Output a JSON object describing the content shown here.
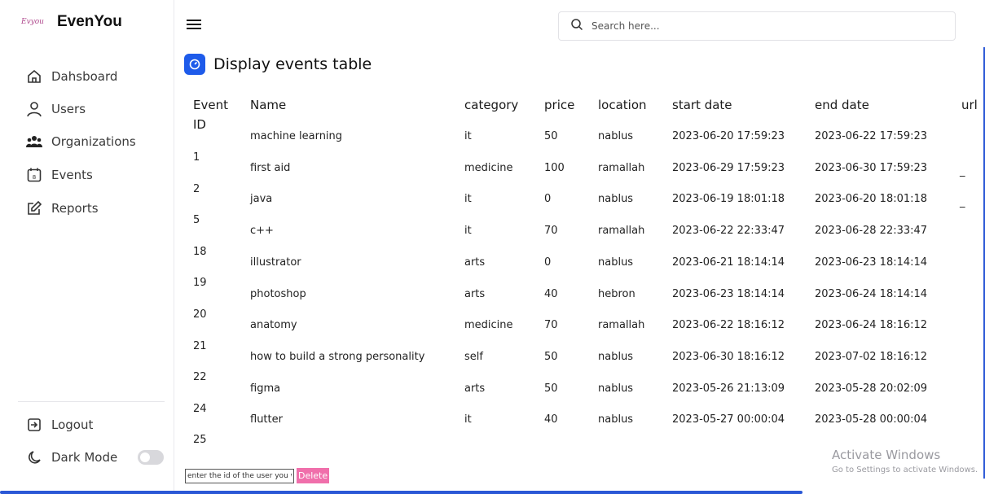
{
  "brand": {
    "logo_text": "Evyou",
    "name": "EvenYou"
  },
  "sidebar": {
    "items": [
      {
        "label": "Dahsboard",
        "icon": "home-icon"
      },
      {
        "label": "Users",
        "icon": "user-icon"
      },
      {
        "label": "Organizations",
        "icon": "users-group-icon"
      },
      {
        "label": "Events",
        "icon": "calendar-icon"
      },
      {
        "label": "Reports",
        "icon": "edit-report-icon"
      }
    ],
    "logout_label": "Logout",
    "dark_mode_label": "Dark Mode",
    "dark_mode_on": false
  },
  "search": {
    "placeholder": "Search here..."
  },
  "page": {
    "title": "Display events table"
  },
  "table": {
    "headers": {
      "id": "Event ID",
      "name": "Name",
      "category": "category",
      "price": "price",
      "location": "location",
      "start": "start date",
      "end": "end date",
      "url": "url"
    },
    "ids": [
      "1",
      "2",
      "5",
      "18",
      "19",
      "20",
      "21",
      "22",
      "24",
      "25"
    ],
    "rows": [
      {
        "name": "machine learning",
        "category": "it",
        "price": "50",
        "location": "nablus",
        "start": "2023-06-20 17:59:23",
        "end": "2023-06-22 17:59:23",
        "url": ""
      },
      {
        "name": "first aid",
        "category": "medicine",
        "price": "100",
        "location": "ramallah",
        "start": "2023-06-29 17:59:23",
        "end": "2023-06-30 17:59:23",
        "url": "_"
      },
      {
        "name": "java",
        "category": "it",
        "price": "0",
        "location": "nablus",
        "start": "2023-06-19 18:01:18",
        "end": "2023-06-20 18:01:18",
        "url": "_"
      },
      {
        "name": "c++",
        "category": "it",
        "price": "70",
        "location": "ramallah",
        "start": "2023-06-22 22:33:47",
        "end": "2023-06-28 22:33:47",
        "url": ""
      },
      {
        "name": "illustrator",
        "category": "arts",
        "price": "0",
        "location": "nablus",
        "start": "2023-06-21 18:14:14",
        "end": "2023-06-23 18:14:14",
        "url": ""
      },
      {
        "name": "photoshop",
        "category": "arts",
        "price": "40",
        "location": "hebron",
        "start": "2023-06-23 18:14:14",
        "end": "2023-06-24 18:14:14",
        "url": ""
      },
      {
        "name": "anatomy",
        "category": "medicine",
        "price": "70",
        "location": "ramallah",
        "start": "2023-06-22 18:16:12",
        "end": "2023-06-24 18:16:12",
        "url": ""
      },
      {
        "name": "how to build a strong personality",
        "category": "self",
        "price": "50",
        "location": "nablus",
        "start": "2023-06-30 18:16:12",
        "end": "2023-07-02 18:16:12",
        "url": ""
      },
      {
        "name": "figma",
        "category": "arts",
        "price": "50",
        "location": "nablus",
        "start": "2023-05-26 21:13:09",
        "end": "2023-05-28 20:02:09",
        "url": ""
      },
      {
        "name": "flutter",
        "category": "it",
        "price": "40",
        "location": "nablus",
        "start": "2023-05-27 00:00:04",
        "end": "2023-05-28 00:00:04",
        "url": ""
      }
    ]
  },
  "delete": {
    "placeholder": "enter the id of the user you want to delete",
    "button_label": "Delete"
  },
  "watermark": {
    "line1": "Activate Windows",
    "line2": "Go to Settings to activate Windows."
  },
  "colors": {
    "accent": "#1e5bea",
    "delete": "#f06fab",
    "bar": "#2b58d6"
  }
}
